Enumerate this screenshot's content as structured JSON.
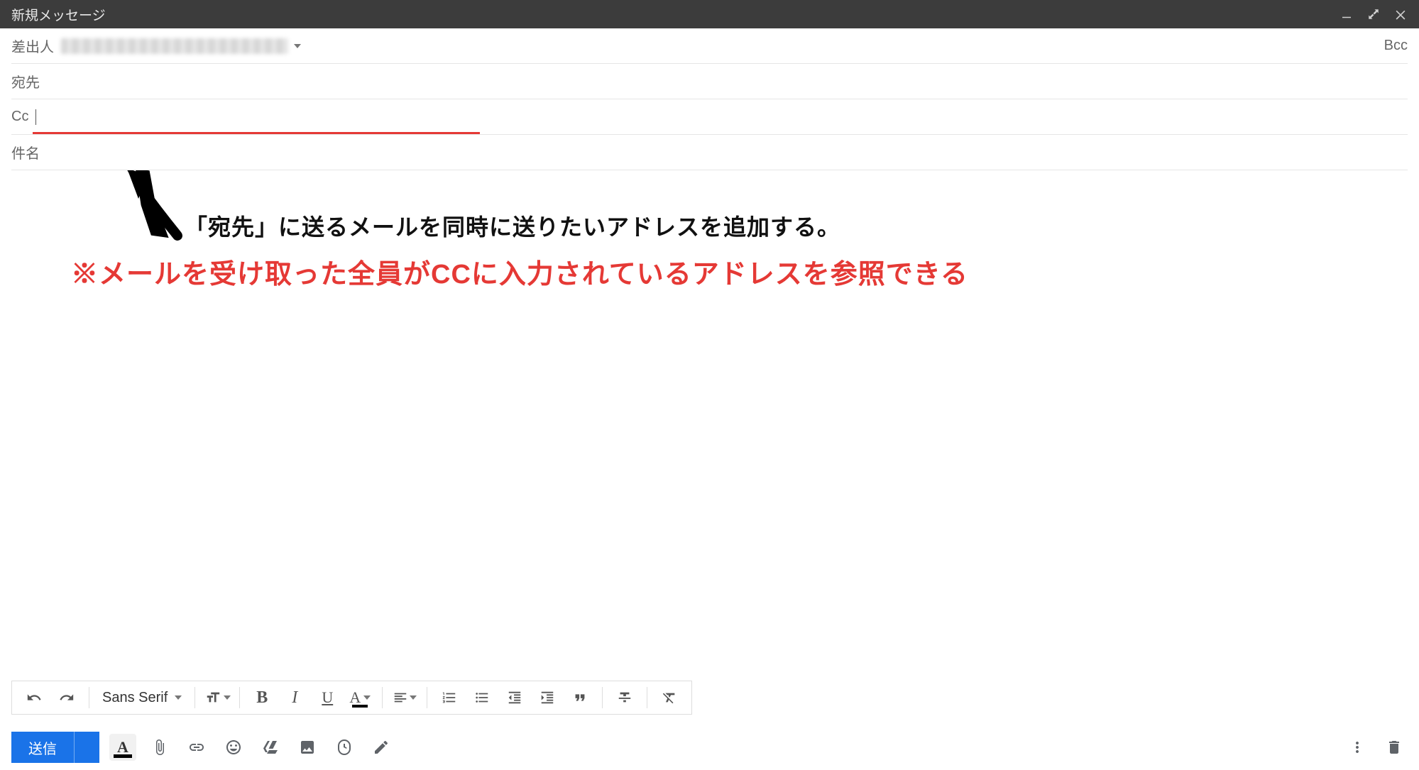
{
  "titlebar": {
    "title": "新規メッセージ"
  },
  "fields": {
    "from_label": "差出人",
    "to_label": "宛先",
    "cc_label": "Cc",
    "bcc_label": "Bcc",
    "subject_label": "件名"
  },
  "annotations": {
    "line1": "「宛先」に送るメールを同時に送りたいアドレスを追加する。",
    "line2": "※メールを受け取った全員がCCに入力されているアドレスを参照できる"
  },
  "format_toolbar": {
    "font": "Sans Serif"
  },
  "bottom": {
    "send": "送信"
  }
}
